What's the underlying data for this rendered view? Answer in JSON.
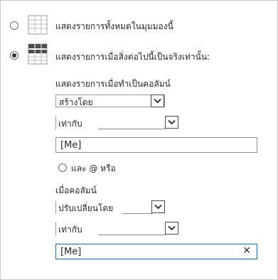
{
  "view_options": {
    "all_items_label": "แสดงรายการทั้งหมดในมุมมองนี้",
    "filtered_items_label": "แสดงรายการเมื่อสิ่งต่อไปนี้เป็นจริงเท่านั้น:"
  },
  "filter": {
    "section_label": "แสดงรายการเมื่อทำเป็นคอลัมน์",
    "column1": "สร้างโดย",
    "operator1": "เท่ากับ",
    "value1": "[Me]",
    "and_or_label": "และ @ หรือ",
    "column_section_label": "เมื่อคอลัมน์",
    "column2": "ปรับเปลี่ยนโดย",
    "operator2": "เท่ากับ",
    "value2": "[Me]"
  }
}
